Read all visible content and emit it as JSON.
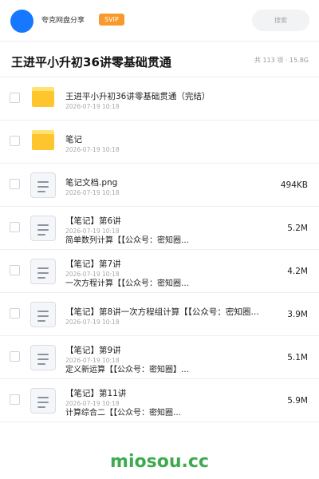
{
  "header": {
    "app_name": "夸克网盘分享",
    "badge": "SVIP",
    "search_label": "搜索",
    "brand_color": "#1677ff",
    "badge_color": "#f79a2b"
  },
  "folder": {
    "title": "王进平小升初36讲零基础贯通",
    "meta": "共 113 项 · 15.8G"
  },
  "files": [
    {
      "type": "folder",
      "name": "王进平小升初36讲零基础贯通（完结）",
      "date": "2026-07-19 10:18",
      "size": ""
    },
    {
      "type": "folder",
      "name": "笔记",
      "date": "2026-07-19 10:18",
      "size": ""
    },
    {
      "type": "doc",
      "name": "笔记文档.png",
      "date": "2026-07-19 10:18",
      "size": "494KB"
    },
    {
      "type": "doc",
      "name": "【笔记】第6讲",
      "sub": "简单数列计算【【公众号：密知圈…",
      "date": "2026-07-19 10:18",
      "size": "5.2M"
    },
    {
      "type": "doc",
      "name": "【笔记】第7讲",
      "sub": "一次方程计算【【公众号：密知圈…",
      "date": "2026-07-19 10:18",
      "size": "4.2M"
    },
    {
      "type": "doc",
      "name": "【笔记】第8讲一次方程组计算【【公众号：密知圈…",
      "date": "2026-07-19 10:18",
      "size": "3.9M"
    },
    {
      "type": "doc",
      "name": "【笔记】第9讲",
      "sub": "定义新运算【【公众号：密知圈】…",
      "date": "2026-07-19 10:18",
      "size": "5.1M"
    },
    {
      "type": "doc",
      "name": "【笔记】第11讲",
      "sub": "计算综合二【【公众号：密知圈…",
      "date": "2026-07-19 10:18",
      "size": "5.9M"
    }
  ],
  "watermark": "miosou.cc"
}
